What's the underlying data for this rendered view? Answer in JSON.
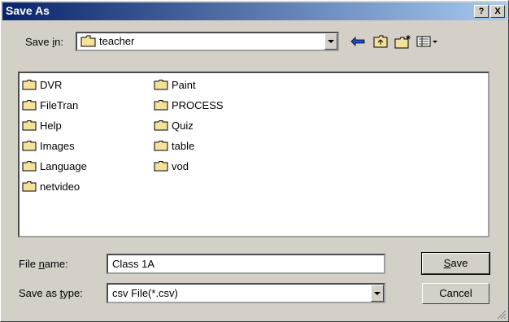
{
  "window": {
    "title": "Save As",
    "help_btn": "?",
    "close_btn": "X"
  },
  "save_in": {
    "label_pre": "Save ",
    "label_hot": "i",
    "label_post": "n:",
    "value": "teacher"
  },
  "toolbar": {
    "icons": [
      "back-arrow-icon",
      "up-folder-icon",
      "new-folder-icon",
      "view-menu-icon"
    ]
  },
  "folders": {
    "col1": [
      "DVR",
      "FileTran",
      "Help",
      "Images",
      "Language",
      "netvideo"
    ],
    "col2": [
      "Paint",
      "PROCESS",
      "Quiz",
      "table",
      "vod"
    ]
  },
  "file_name": {
    "label_pre": "File ",
    "label_hot": "n",
    "label_post": "ame:",
    "value": "Class 1A"
  },
  "save_type": {
    "label_pre": "Save as ",
    "label_hot": "t",
    "label_post": "ype:",
    "value": "csv File(*.csv)"
  },
  "buttons": {
    "save_hot": "S",
    "save_rest": "ave",
    "cancel": "Cancel"
  },
  "colors": {
    "titlebar_start": "#0a246a",
    "titlebar_end": "#a6caf0",
    "face": "#d4d0c8",
    "folder": "#f5e29a"
  }
}
